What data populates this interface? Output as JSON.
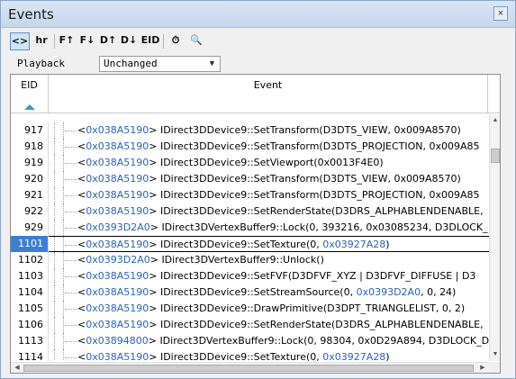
{
  "window": {
    "title": "Events",
    "close_label": "×"
  },
  "toolbar": {
    "buttons": [
      {
        "label": "<>",
        "icon": "toggle-view-icon",
        "active": true
      },
      {
        "label": "hr",
        "icon": "hr-icon",
        "active": false
      },
      {
        "label": "F↑",
        "icon": "find-prev-icon",
        "active": false
      },
      {
        "label": "F↓",
        "icon": "find-next-icon",
        "active": false
      },
      {
        "label": "D↑",
        "icon": "draw-prev-icon",
        "active": false
      },
      {
        "label": "D↓",
        "icon": "draw-next-icon",
        "active": false
      },
      {
        "label": "EID",
        "icon": "goto-eid-icon",
        "active": false
      },
      {
        "label": "⏱",
        "icon": "timer-icon",
        "active": false
      },
      {
        "label": "🔍",
        "icon": "search-icon",
        "active": false
      }
    ]
  },
  "playback": {
    "label": "Playback",
    "selected": "Unchanged"
  },
  "table": {
    "columns": [
      "EID",
      "Event"
    ],
    "sort_column": "EID",
    "sort_direction": "ascending",
    "rows": [
      {
        "eid": "917",
        "addr": "0x038A5190",
        "text": "IDirect3DDevice9::SetTransform(D3DTS_VIEW, 0x009A8570)",
        "hl": "",
        "tail": ""
      },
      {
        "eid": "918",
        "addr": "0x038A5190",
        "text": "IDirect3DDevice9::SetTransform(D3DTS_PROJECTION, 0x009A85",
        "hl": "",
        "tail": ""
      },
      {
        "eid": "919",
        "addr": "0x038A5190",
        "text": "IDirect3DDevice9::SetViewport(0x0013F4E0)",
        "hl": "",
        "tail": ""
      },
      {
        "eid": "920",
        "addr": "0x038A5190",
        "text": "IDirect3DDevice9::SetTransform(D3DTS_VIEW, 0x009A8570)",
        "hl": "",
        "tail": ""
      },
      {
        "eid": "921",
        "addr": "0x038A5190",
        "text": "IDirect3DDevice9::SetTransform(D3DTS_PROJECTION, 0x009A85",
        "hl": "",
        "tail": ""
      },
      {
        "eid": "922",
        "addr": "0x038A5190",
        "text": "IDirect3DDevice9::SetRenderState(D3DRS_ALPHABLENDENABLE,",
        "hl": "",
        "tail": ""
      },
      {
        "eid": "929",
        "addr": "0x0393D2A0",
        "text": "IDirect3DVertexBuffer9::Lock(0, 393216, 0x03085234, D3DLOCK_",
        "hl": "",
        "tail": ""
      },
      {
        "eid": "1101",
        "addr": "0x038A5190",
        "text": "IDirect3DDevice9::SetTexture(0, ",
        "hl": "0x03927A28",
        "tail": ")",
        "selected": true
      },
      {
        "eid": "1102",
        "addr": "0x0393D2A0",
        "text": "IDirect3DVertexBuffer9::Unlock()",
        "hl": "",
        "tail": ""
      },
      {
        "eid": "1103",
        "addr": "0x038A5190",
        "text": "IDirect3DDevice9::SetFVF(D3DFVF_XYZ | D3DFVF_DIFFUSE | D3",
        "hl": "",
        "tail": ""
      },
      {
        "eid": "1104",
        "addr": "0x038A5190",
        "text": "IDirect3DDevice9::SetStreamSource(0, ",
        "hl": "0x0393D2A0",
        "tail": ", 0, 24)"
      },
      {
        "eid": "1105",
        "addr": "0x038A5190",
        "text": "IDirect3DDevice9::DrawPrimitive(D3DPT_TRIANGLELIST, 0, 2)",
        "hl": "",
        "tail": ""
      },
      {
        "eid": "1106",
        "addr": "0x038A5190",
        "text": "IDirect3DDevice9::SetRenderState(D3DRS_ALPHABLENDENABLE,",
        "hl": "",
        "tail": ""
      },
      {
        "eid": "1113",
        "addr": "0x03894800",
        "text": "IDirect3DVertexBuffer9::Lock(0, 98304, 0x0D29A894, D3DLOCK_D",
        "hl": "",
        "tail": ""
      },
      {
        "eid": "1114",
        "addr": "0x038A5190",
        "text": "IDirect3DDevice9::SetTexture(0, ",
        "hl": "0x03927A28",
        "tail": ")"
      }
    ]
  },
  "colors": {
    "accent": "#3d7fd6",
    "link": "#2c62b8",
    "title_bar": "#c6d6ec"
  }
}
